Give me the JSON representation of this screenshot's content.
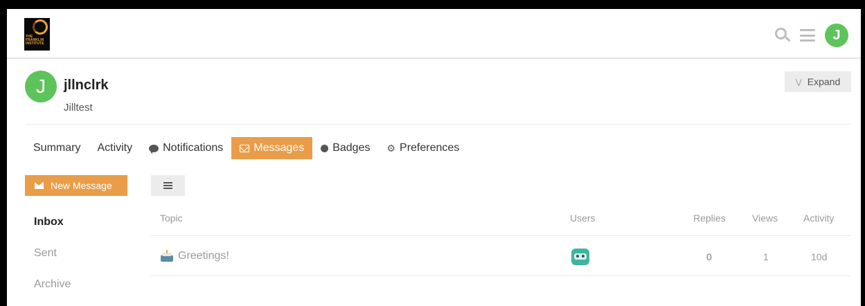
{
  "header": {
    "logo_text": "THE FRANKLIN INSTITUTE",
    "avatar_letter": "J",
    "icons": [
      "search-icon",
      "hamburger-menu-icon",
      "user-avatar"
    ]
  },
  "profile": {
    "avatar_letter": "J",
    "username": "jllnclrk",
    "full_name": "Jilltest",
    "expand_label": "Expand",
    "avatar_color": "#5dc35a"
  },
  "nav": {
    "summary": "Summary",
    "activity": "Activity",
    "notifications": "Notifications",
    "messages": "Messages",
    "badges": "Badges",
    "preferences": "Preferences",
    "active": "Messages",
    "accent_color": "#e99d49"
  },
  "toolbar": {
    "new_message": "New Message"
  },
  "sidebar": {
    "items": [
      {
        "label": "Inbox",
        "active": true
      },
      {
        "label": "Sent",
        "active": false
      },
      {
        "label": "Archive",
        "active": false
      }
    ]
  },
  "table": {
    "headers": {
      "topic": "Topic",
      "users": "Users",
      "replies": "Replies",
      "views": "Views",
      "activity": "Activity"
    },
    "rows": [
      {
        "topic": "Greetings!",
        "topic_icon": "cake-icon",
        "user_icon": "robot-avatar-icon",
        "replies": "0",
        "views": "1",
        "activity": "10d"
      }
    ]
  }
}
